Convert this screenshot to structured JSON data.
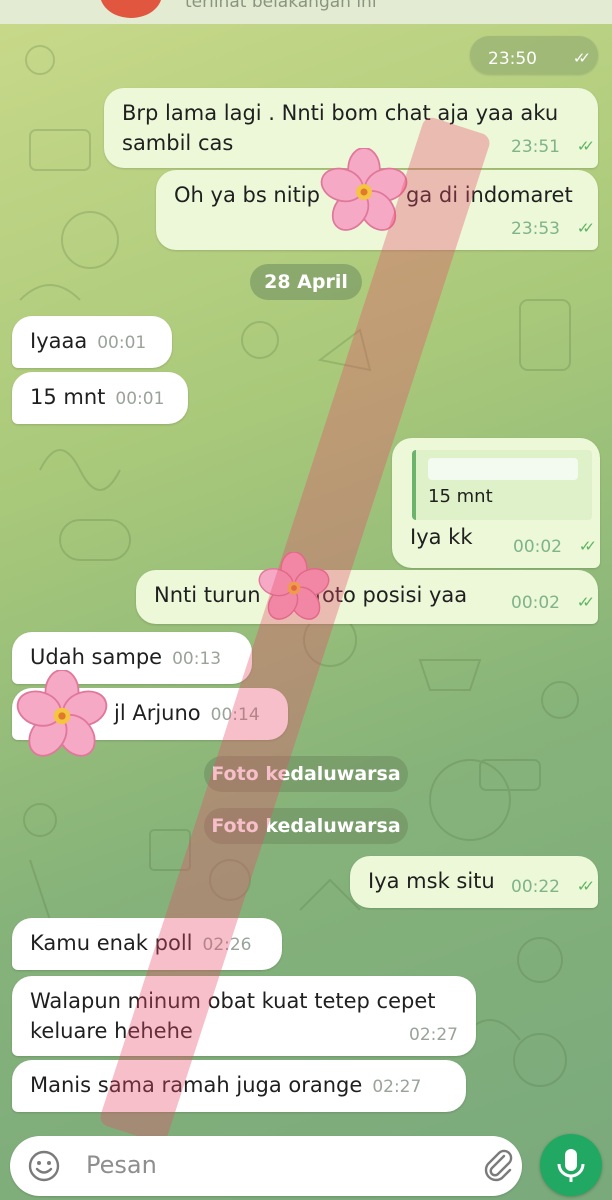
{
  "header": {
    "snippet": "terlihat belakangan ini"
  },
  "messages": [
    {
      "id": "m0",
      "side": "out",
      "time": "23:50"
    },
    {
      "id": "m1",
      "side": "out",
      "text_line1": "Brp lama lagi . Nnti bom chat aja yaa aku",
      "text_line2": "sambil cas",
      "time": "23:51"
    },
    {
      "id": "m2",
      "side": "out",
      "text_a": "Oh ya bs nitip",
      "text_b": "ga di indomaret",
      "time": "23:53"
    },
    {
      "id": "m3",
      "side": "in",
      "text": "Iyaaa",
      "time": "00:01"
    },
    {
      "id": "m4",
      "side": "in",
      "text": "15 mnt",
      "time": "00:01"
    },
    {
      "id": "m5",
      "side": "out",
      "reply_quote": "15 mnt",
      "text": "Iya kk",
      "time": "00:02"
    },
    {
      "id": "m6",
      "side": "out",
      "text_a": "Nnti turun",
      "text_b": "foto posisi yaa",
      "time": "00:02"
    },
    {
      "id": "m7",
      "side": "in",
      "text": "Udah sampe",
      "time": "00:13"
    },
    {
      "id": "m8",
      "side": "in",
      "text": "jl Arjuno",
      "time": "00:14"
    },
    {
      "id": "m9",
      "side": "out",
      "text": "Iya msk situ",
      "time": "00:22"
    },
    {
      "id": "m10",
      "side": "in",
      "text": "Kamu enak poll",
      "time": "02:26"
    },
    {
      "id": "m11",
      "side": "in",
      "text_line1": "Walapun minum obat kuat tetep cepet",
      "text_line2": "keluare hehehe",
      "time": "02:27"
    },
    {
      "id": "m12",
      "side": "in",
      "text": "Manis sama ramah juga orange",
      "time": "02:27"
    }
  ],
  "date_separator": "28 April",
  "system_notices": [
    "Foto kedaluwarsa",
    "Foto kedaluwarsa"
  ],
  "composer": {
    "placeholder": "Pesan"
  },
  "colors": {
    "incoming_bubble": "#ffffff",
    "outgoing_bubble": "#ecf8d8",
    "read_ticks": "#5fb360",
    "mic_button": "#21a862",
    "watermark": "#e84b6a"
  },
  "icons": [
    "emoji-icon",
    "attach-icon",
    "mic-icon",
    "double-check-icon",
    "sakura-flower-sticker"
  ]
}
